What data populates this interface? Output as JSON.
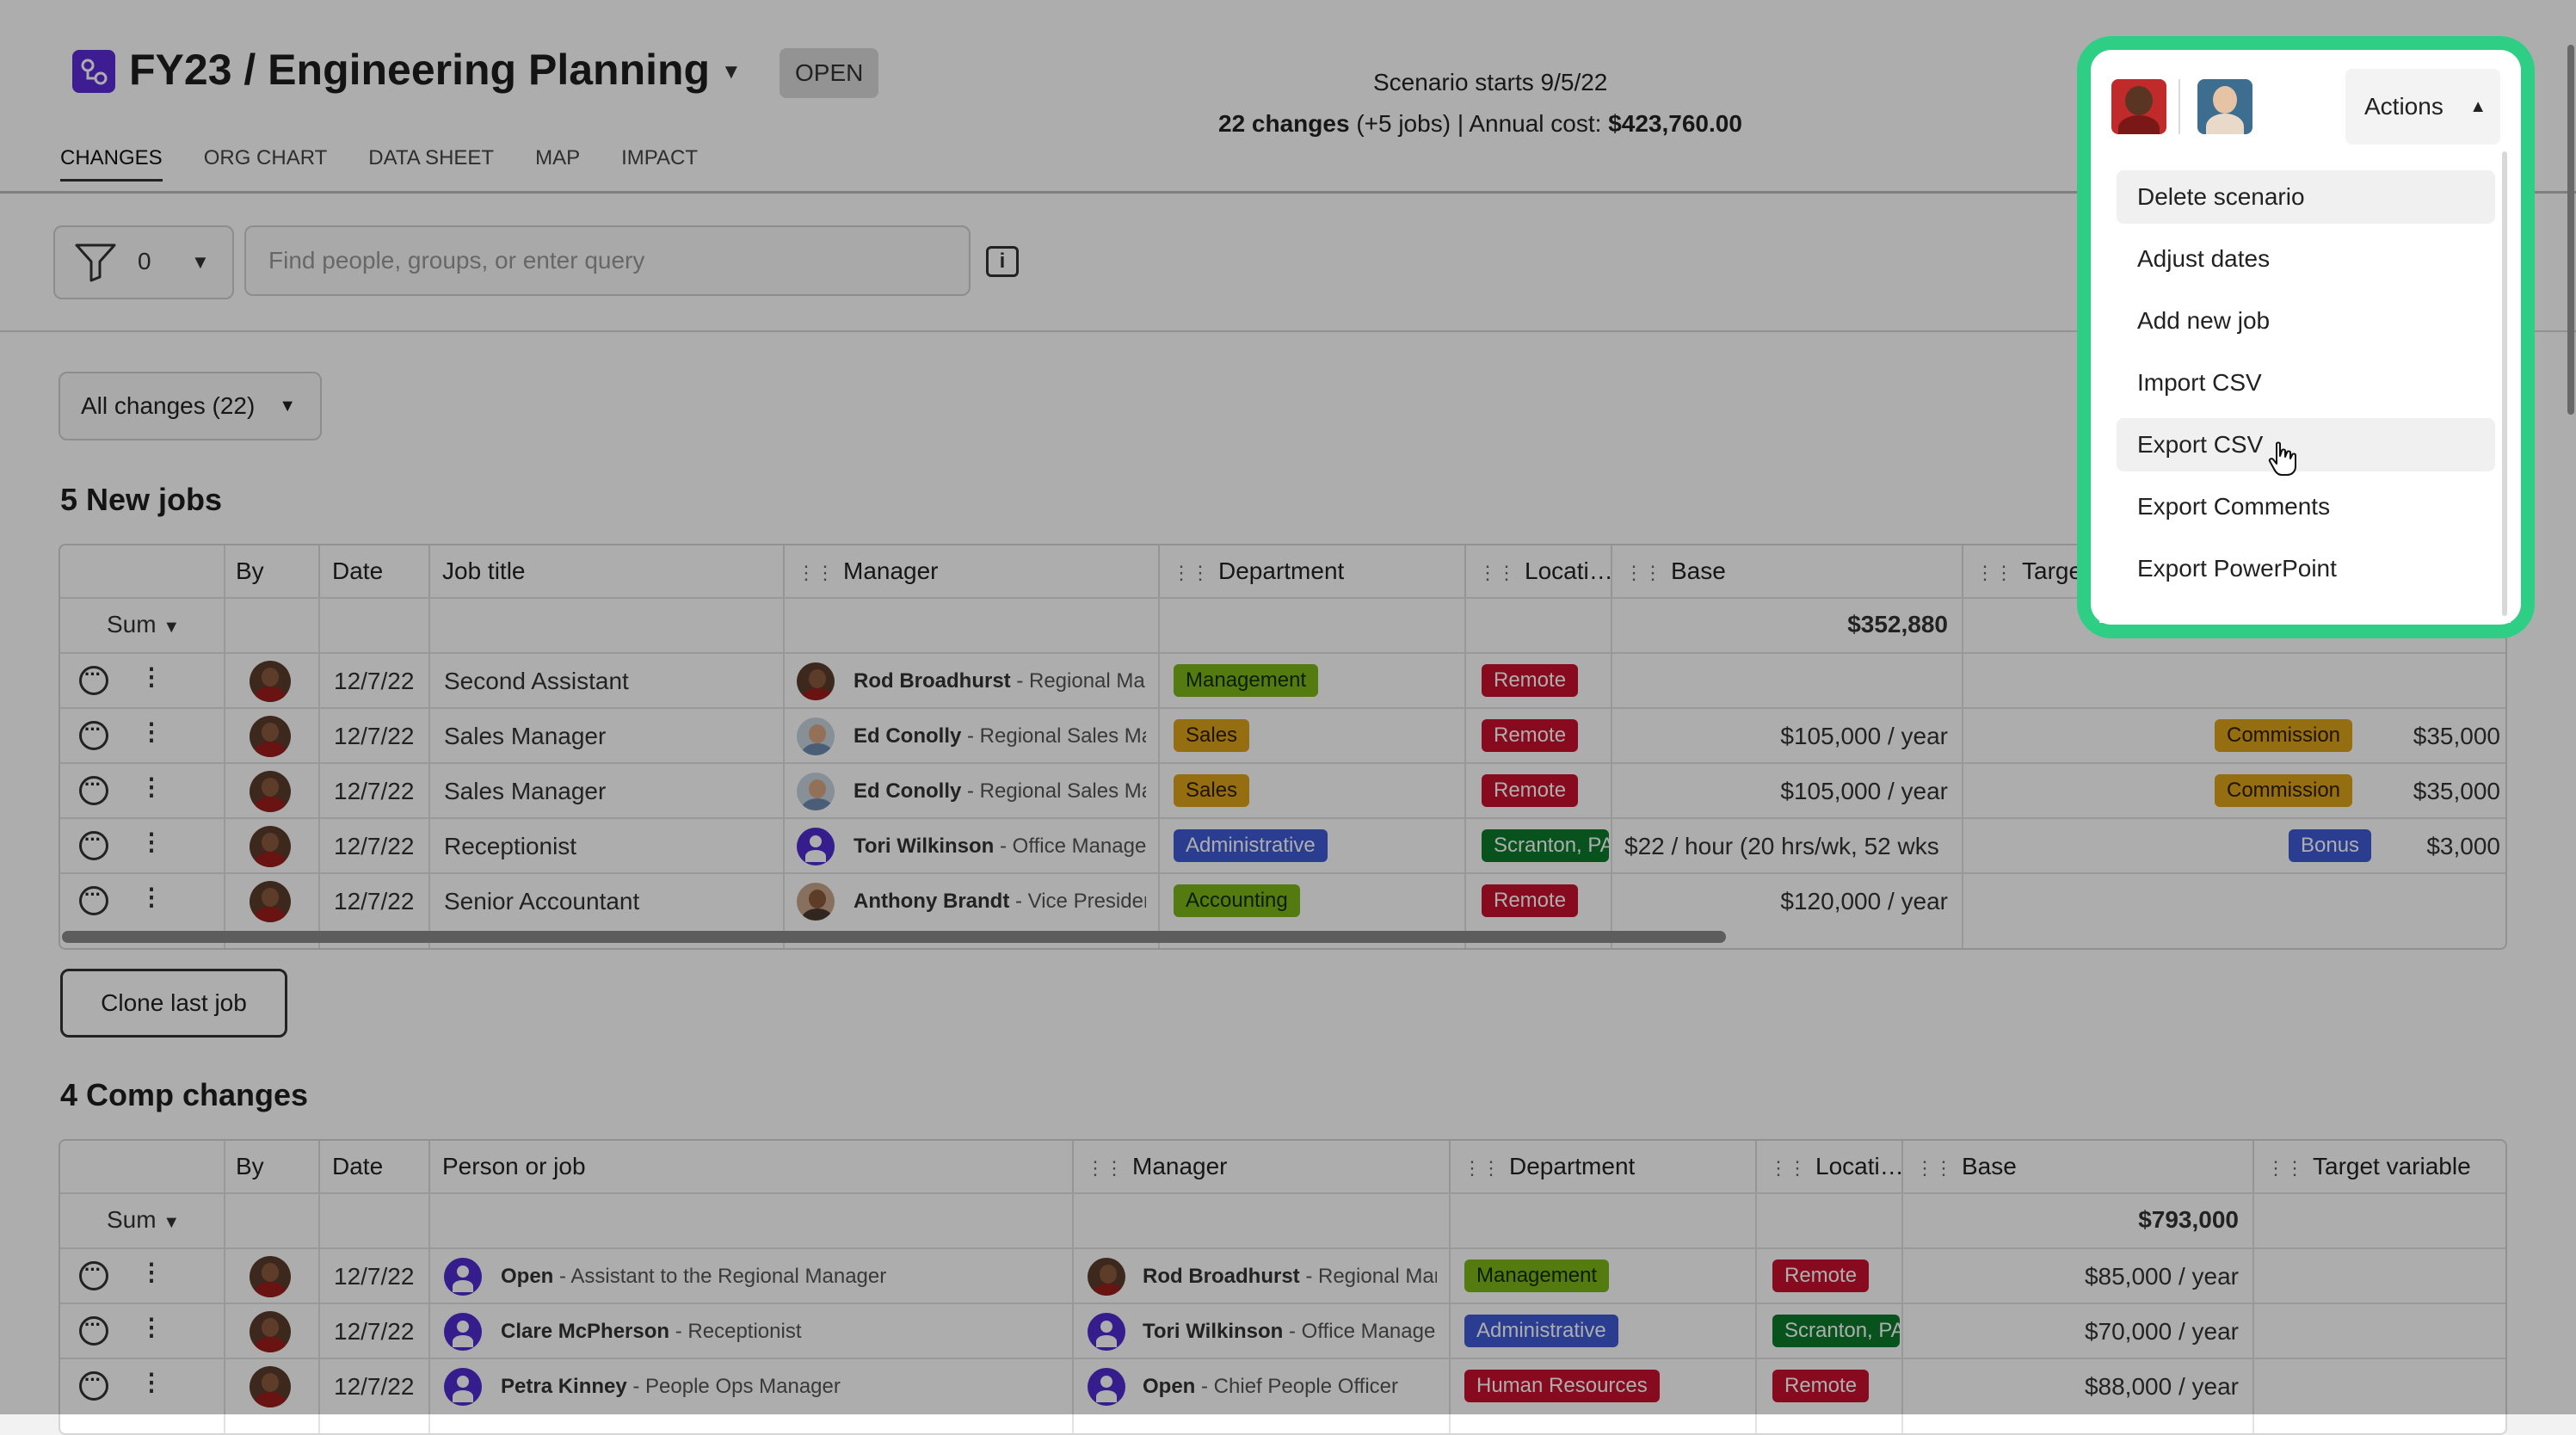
{
  "header": {
    "title": "FY23 / Engineering Planning",
    "status_badge": "OPEN",
    "scenario_start": "Scenario starts 9/5/22",
    "changes_count": "22 changes",
    "jobs_delta": "(+5 jobs)",
    "cost_label": "| Annual cost:",
    "annual_cost": "$423,760.00"
  },
  "tabs": [
    "CHANGES",
    "ORG CHART",
    "DATA SHEET",
    "MAP",
    "IMPACT"
  ],
  "filter": {
    "count": "0",
    "search_placeholder": "Find people, groups, or enter query"
  },
  "changes_dropdown": "All changes (22)",
  "new_jobs": {
    "title": "5 New jobs",
    "columns": [
      "By",
      "Date",
      "Job title",
      "Manager",
      "Department",
      "Locati…",
      "Base",
      "Target"
    ],
    "sum_label": "Sum",
    "sum_base": "$352,880",
    "rows": [
      {
        "date": "12/7/22",
        "job": "Second Assistant",
        "mgr": "Rod Broadhurst",
        "mgr_role": "- Regional Mar",
        "dept": "Management",
        "loc": "Remote",
        "base": "",
        "var_type": "",
        "var_amt": ""
      },
      {
        "date": "12/7/22",
        "job": "Sales Manager",
        "mgr": "Ed Conolly",
        "mgr_role": "- Regional Sales Ma",
        "dept": "Sales",
        "loc": "Remote",
        "base": "$105,000 / year",
        "var_type": "Commission",
        "var_amt": "$35,000"
      },
      {
        "date": "12/7/22",
        "job": "Sales Manager",
        "mgr": "Ed Conolly",
        "mgr_role": "- Regional Sales Ma",
        "dept": "Sales",
        "loc": "Remote",
        "base": "$105,000 / year",
        "var_type": "Commission",
        "var_amt": "$35,000"
      },
      {
        "date": "12/7/22",
        "job": "Receptionist",
        "mgr": "Tori Wilkinson",
        "mgr_role": "- Office Manage",
        "dept": "Administrative",
        "loc": "Scranton, PA",
        "base": "$22 / hour (20 hrs/wk, 52 wks",
        "var_type": "Bonus",
        "var_amt": "$3,000"
      },
      {
        "date": "12/7/22",
        "job": "Senior Accountant",
        "mgr": "Anthony Brandt",
        "mgr_role": "- Vice Presiden",
        "dept": "Accounting",
        "loc": "Remote",
        "base": "$120,000 / year",
        "var_type": "",
        "var_amt": ""
      }
    ]
  },
  "clone_button": "Clone last job",
  "comp_changes": {
    "title": "4 Comp changes",
    "columns": [
      "By",
      "Date",
      "Person or job",
      "Manager",
      "Department",
      "Locati…",
      "Base",
      "Target variable"
    ],
    "sum_label": "Sum",
    "sum_base": "$793,000",
    "rows": [
      {
        "date": "12/7/22",
        "person": "Open",
        "person_role": "- Assistant to the Regional Manager",
        "mgr": "Rod Broadhurst",
        "mgr_role": "- Regional Mar",
        "dept": "Management",
        "loc": "Remote",
        "base": "$85,000 / year"
      },
      {
        "date": "12/7/22",
        "person": "Clare McPherson",
        "person_role": "- Receptionist",
        "mgr": "Tori Wilkinson",
        "mgr_role": "- Office Manage",
        "dept": "Administrative",
        "loc": "Scranton, PA",
        "base": "$70,000 / year"
      },
      {
        "date": "12/7/22",
        "person": "Petra Kinney",
        "person_role": "- People Ops Manager",
        "mgr": "Open",
        "mgr_role": "- Chief People Officer",
        "dept": "Human Resources",
        "loc": "Remote",
        "base": "$88,000 / year"
      }
    ]
  },
  "actions_menu": {
    "button_label": "Actions",
    "items": [
      "Delete scenario",
      "Adjust dates",
      "Add new job",
      "Import CSV",
      "Export CSV",
      "Export Comments",
      "Export PowerPoint"
    ]
  },
  "colors": {
    "accent_frame": "#2ecf84",
    "brand": "#5b2bd6"
  },
  "icons": [
    "app-logo-icon",
    "caret-down-icon",
    "filter-funnel-icon",
    "info-icon",
    "comment-icon",
    "kebab-icon",
    "caret-up-icon",
    "pointer-cursor-icon"
  ]
}
